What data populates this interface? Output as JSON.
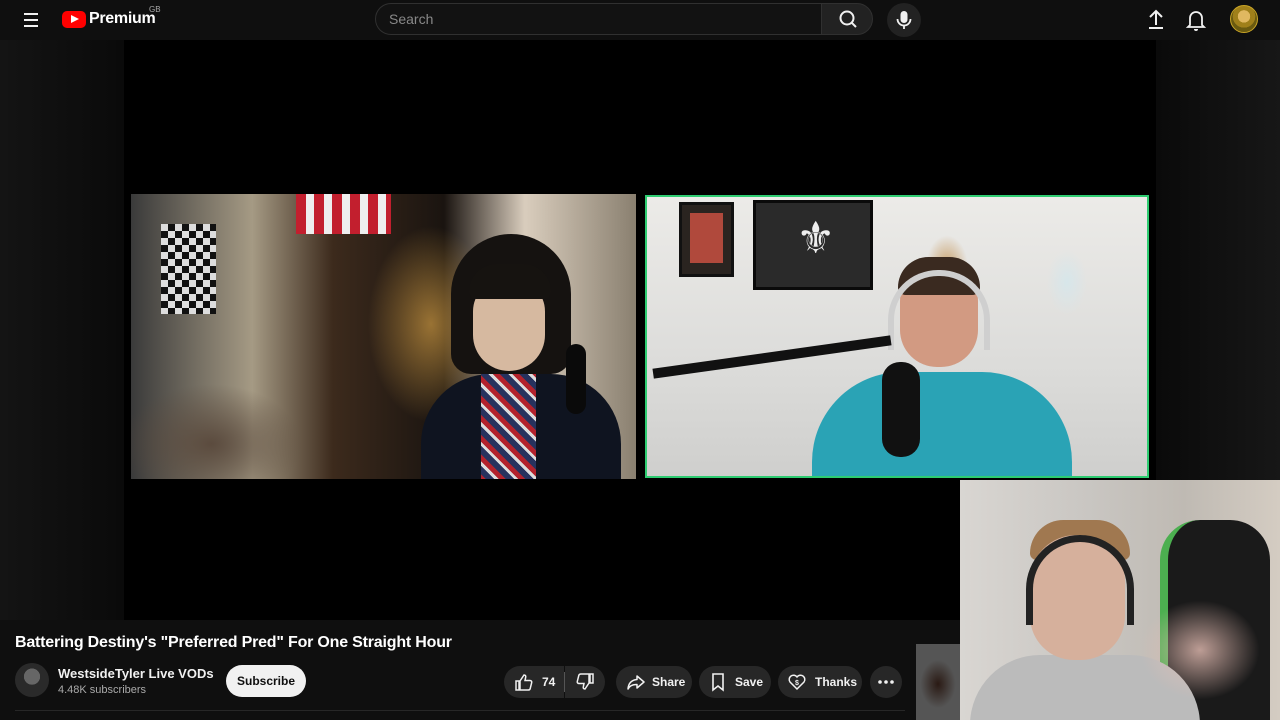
{
  "header": {
    "logo_text": "Premium",
    "country_code": "GB",
    "search_placeholder": "Search"
  },
  "video": {
    "title": "Battering Destiny's \"Preferred Pred\" For One Straight Hour"
  },
  "channel": {
    "name": "WestsideTyler Live VODs",
    "subscribers": "4.48K subscribers",
    "subscribe_label": "Subscribe"
  },
  "actions": {
    "like_count": "74",
    "share_label": "Share",
    "save_label": "Save",
    "thanks_label": "Thanks"
  },
  "colors": {
    "brand_red": "#ff0000",
    "active_speaker_border": "#2ecc71"
  }
}
